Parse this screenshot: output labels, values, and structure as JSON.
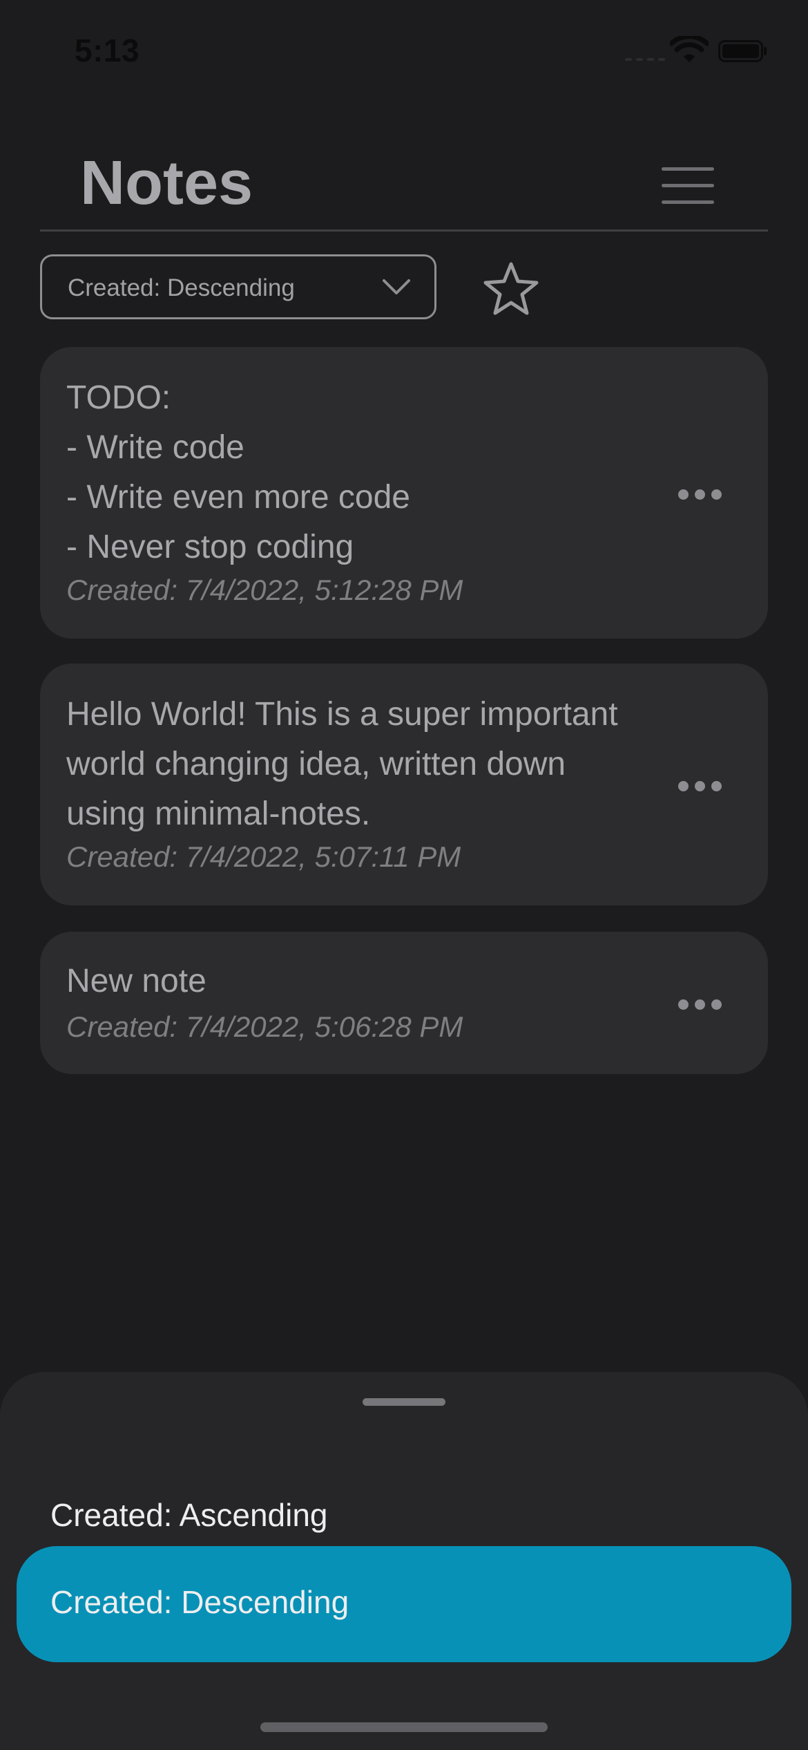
{
  "status_bar": {
    "time": "5:13"
  },
  "header": {
    "title": "Notes",
    "menu_icon": "hamburger-menu-icon"
  },
  "toolbar": {
    "sort_value": "Created: Descending",
    "sort_icon": "chevron-down-icon",
    "favorite_icon": "star-outline-icon"
  },
  "notes": [
    {
      "lines": [
        "TODO:",
        "- Write code",
        "- Write even more code",
        "- Never stop coding"
      ],
      "date": "Created: 7/4/2022, 5:12:28 PM"
    },
    {
      "lines": [
        "Hello World! This is a super important",
        "world changing idea, written down",
        "using minimal-notes."
      ],
      "date": "Created: 7/4/2022, 5:07:11 PM"
    },
    {
      "lines": [
        "New note"
      ],
      "date": "Created: 7/4/2022, 5:06:28 PM"
    }
  ],
  "sort_sheet": {
    "options": [
      {
        "label": "Created: Ascending",
        "selected": false
      },
      {
        "label": "Created: Descending",
        "selected": true
      }
    ],
    "selected_color": "#0891b6"
  },
  "colors": {
    "background": "#1c1c1e",
    "card": "#2c2c2f",
    "sheet": "#262628"
  }
}
